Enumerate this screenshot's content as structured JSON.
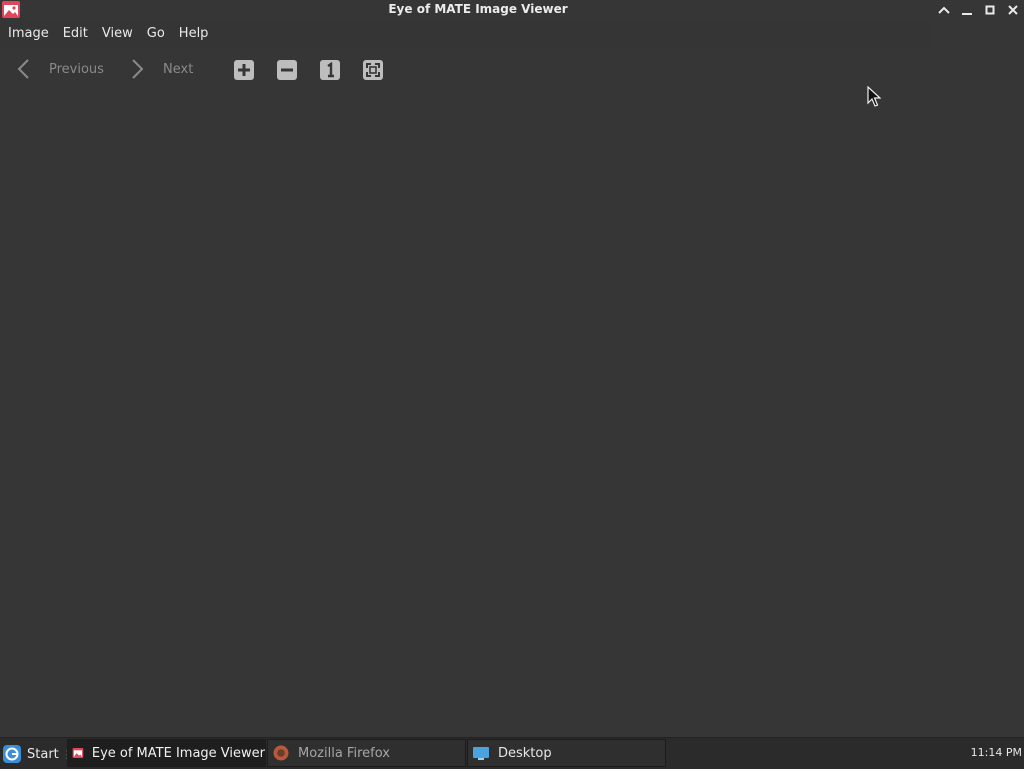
{
  "window": {
    "title": "Eye of MATE Image Viewer",
    "icon": "image-viewer-icon"
  },
  "window_controls": [
    "shade-icon",
    "minimize-icon",
    "maximize-icon",
    "close-icon"
  ],
  "menubar": {
    "items": [
      "Image",
      "Edit",
      "View",
      "Go",
      "Help"
    ]
  },
  "toolbar": {
    "previous_label": "Previous",
    "next_label": "Next",
    "icons": [
      "zoom-in-icon",
      "zoom-out-icon",
      "normal-size-icon",
      "best-fit-icon"
    ]
  },
  "taskbar": {
    "start_label": "Start",
    "tasks": [
      {
        "label": "Eye of MATE Image Viewer",
        "icon": "image-viewer-icon",
        "active": true
      },
      {
        "label": "Mozilla Firefox",
        "icon": "firefox-icon",
        "active": false
      },
      {
        "label": "Desktop",
        "icon": "desktop-icon",
        "active": false
      }
    ],
    "clock": "11:14 PM"
  },
  "colors": {
    "background": "#363636",
    "taskbar": "#2b2b2b",
    "app_icon_accent": "#e0455a",
    "disabled_text": "#8a8a8a"
  }
}
